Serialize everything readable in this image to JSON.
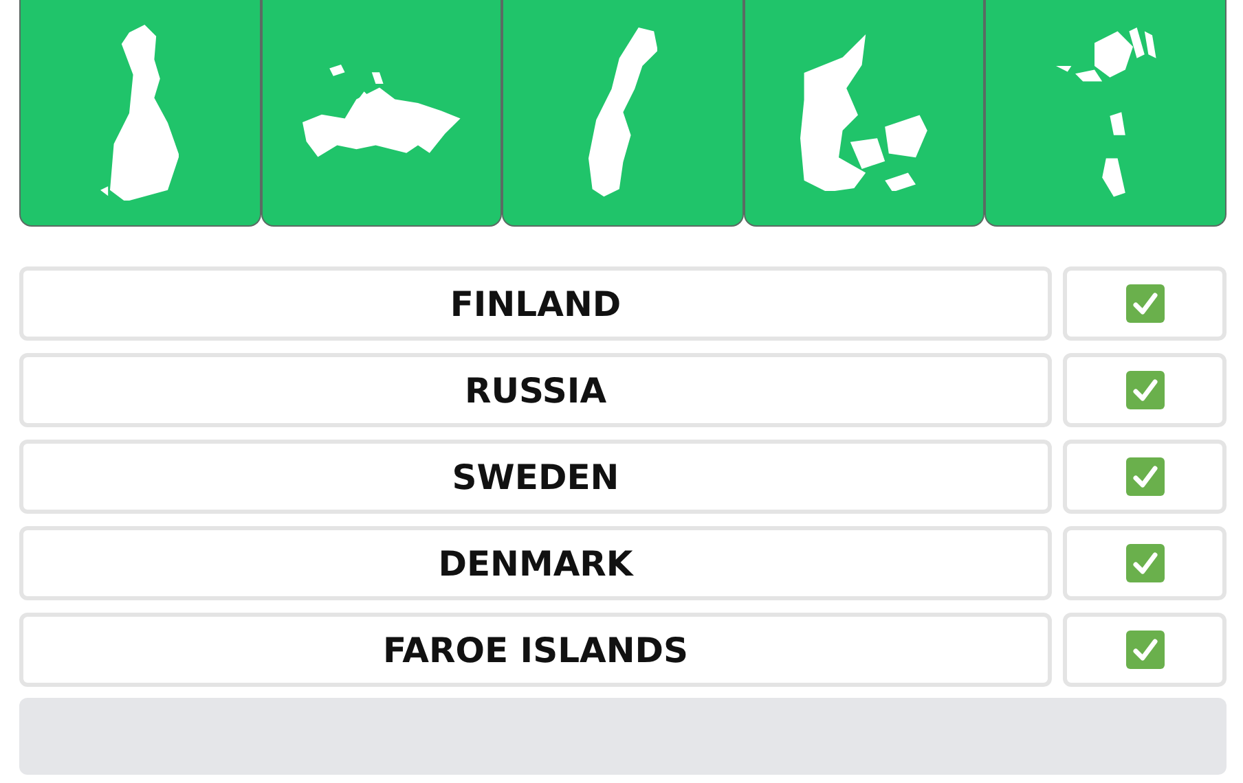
{
  "map_tiles": [
    {
      "kind": "finland"
    },
    {
      "kind": "russia"
    },
    {
      "kind": "sweden"
    },
    {
      "kind": "denmark"
    },
    {
      "kind": "faroe"
    }
  ],
  "answers": [
    {
      "label": "FINLAND",
      "checked": true
    },
    {
      "label": "RUSSIA",
      "checked": true
    },
    {
      "label": "SWEDEN",
      "checked": true
    },
    {
      "label": "DENMARK",
      "checked": true
    },
    {
      "label": "FAROE ISLANDS",
      "checked": true
    }
  ]
}
